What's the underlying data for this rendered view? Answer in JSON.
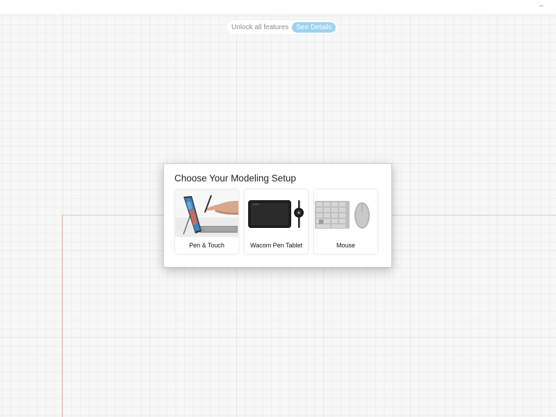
{
  "window": {
    "minimize_glyph": "–"
  },
  "banner": {
    "text": "Unlock all features",
    "button_label": "See Details"
  },
  "dialog": {
    "title": "Choose Your Modeling Setup",
    "options": [
      {
        "label": "Pen & Touch",
        "icon": "pen-touch-icon"
      },
      {
        "label": "Wacom Pen Tablet",
        "icon": "wacom-tablet-icon"
      },
      {
        "label": "Mouse",
        "icon": "mouse-keyboard-icon"
      }
    ]
  },
  "colors": {
    "accent": "#9cd2f0",
    "canvas_bg": "#f7f7f7",
    "grid_major": "#e7e7e7",
    "x_axis": "#c9d4ec",
    "y_axis": "#eab0b0"
  }
}
